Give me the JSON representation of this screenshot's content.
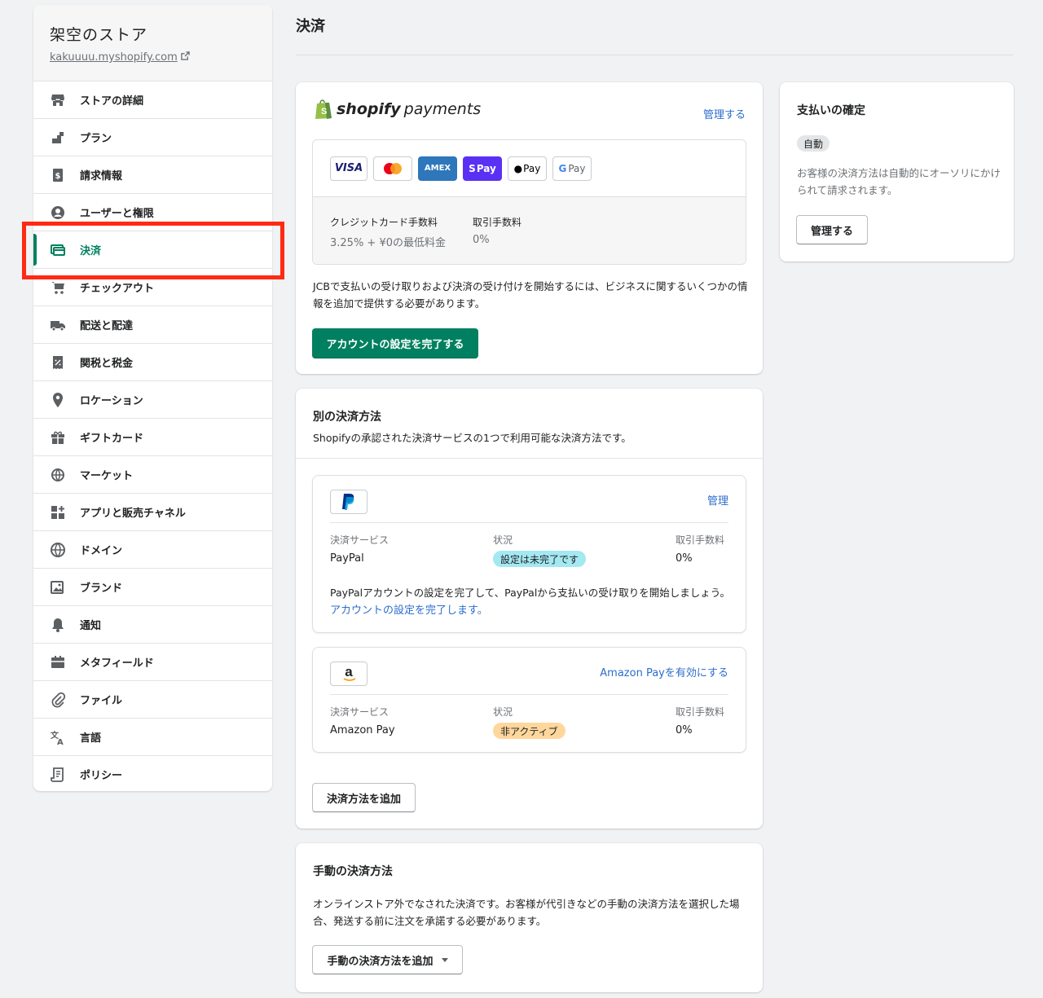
{
  "store": {
    "name": "架空のストア",
    "url": "kakuuuu.myshopify.com"
  },
  "nav": [
    {
      "label": "ストアの詳細",
      "icon": "store-icon"
    },
    {
      "label": "プラン",
      "icon": "plan-icon"
    },
    {
      "label": "請求情報",
      "icon": "billing-icon"
    },
    {
      "label": "ユーザーと権限",
      "icon": "user-icon"
    },
    {
      "label": "決済",
      "icon": "payments-icon",
      "active": true
    },
    {
      "label": "チェックアウト",
      "icon": "cart-icon"
    },
    {
      "label": "配送と配達",
      "icon": "truck-icon"
    },
    {
      "label": "関税と税金",
      "icon": "tax-icon"
    },
    {
      "label": "ロケーション",
      "icon": "location-icon"
    },
    {
      "label": "ギフトカード",
      "icon": "gift-icon"
    },
    {
      "label": "マーケット",
      "icon": "globe-icon"
    },
    {
      "label": "アプリと販売チャネル",
      "icon": "apps-icon"
    },
    {
      "label": "ドメイン",
      "icon": "domain-icon"
    },
    {
      "label": "ブランド",
      "icon": "brand-icon"
    },
    {
      "label": "通知",
      "icon": "bell-icon"
    },
    {
      "label": "メタフィールド",
      "icon": "metafield-icon"
    },
    {
      "label": "ファイル",
      "icon": "paperclip-icon"
    },
    {
      "label": "言語",
      "icon": "language-icon"
    },
    {
      "label": "ポリシー",
      "icon": "policy-icon"
    }
  ],
  "page_title": "決済",
  "shopify_payments": {
    "logo_word1": "shopify",
    "logo_word2": "payments",
    "manage_label": "管理する",
    "card_labels": {
      "visa": "VISA",
      "amex": "AMEX",
      "shop_pay": "Pay",
      "apple_pay": "Pay",
      "google_pay": "Pay"
    },
    "fee_credit_label": "クレジットカード手数料",
    "fee_credit_value": "3.25% + ¥0の最低料金",
    "fee_txn_label": "取引手数料",
    "fee_txn_value": "0%",
    "description": "JCBで支払いの受け取りおよび決済の受け付けを開始するには、ビジネスに関するいくつかの情報を追加で提供する必要があります。",
    "complete_button": "アカウントの設定を完了する"
  },
  "alternative": {
    "title": "別の決済方法",
    "subtitle": "Shopifyの承認された決済サービスの1つで利用可能な決済方法です。",
    "col_service": "決済サービス",
    "col_status": "状況",
    "col_fee": "取引手数料",
    "paypal": {
      "action": "管理",
      "name": "PayPal",
      "status": "設定は未完了です",
      "fee": "0%",
      "desc_text": "PayPalアカウントの設定を完了して、PayPalから支払いの受け取りを開始しましょう。",
      "desc_link": "アカウントの設定を完了します。"
    },
    "amazon": {
      "logo": "a",
      "action": "Amazon Payを有効にする",
      "name": "Amazon Pay",
      "status": "非アクティブ",
      "fee": "0%"
    },
    "add_button": "決済方法を追加"
  },
  "manual": {
    "title": "手動の決済方法",
    "description": "オンラインストア外でなされた決済です。お客様が代引きなどの手動の決済方法を選択した場合、発送する前に注文を承諾する必要があります。",
    "add_button": "手動の決済方法を追加"
  },
  "capture": {
    "title": "支払いの確定",
    "badge": "自動",
    "description": "お客様の決済方法は自動的にオーソリにかけられて請求されます。",
    "manage_button": "管理する"
  },
  "colors": {
    "accent": "#008060",
    "link": "#2c6ecb",
    "highlight": "#ff2a14"
  }
}
